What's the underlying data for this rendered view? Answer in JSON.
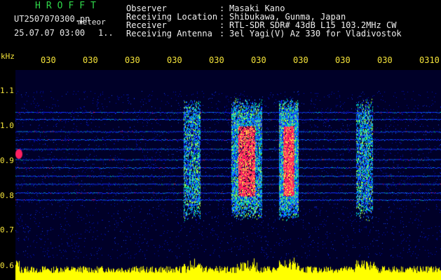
{
  "header": {
    "brand": "HROFFT",
    "filename": "UT2507070300.pn",
    "mode": "meteor",
    "datetime": "25.07.07 03:00",
    "page_indicator": "1.."
  },
  "station_info": [
    {
      "label": "Observer",
      "value": "Masaki Kano"
    },
    {
      "label": "Receiving Location",
      "value": "Shibukawa, Gunma, Japan"
    },
    {
      "label": "Receiver",
      "value": "RTL-SDR SDR# 43dB L15 103.2MHz CW"
    },
    {
      "label": "Receiving Antenna",
      "value": "3el Yagi(V) Az 330 for Vladivostok"
    }
  ],
  "separator": ":",
  "chart_data": {
    "type": "heatmap",
    "ylabel": "kHz",
    "y_ticks": [
      "1.1",
      "1.0",
      "0.9",
      "0.8",
      "0.7",
      "0.6"
    ],
    "ylim": [
      0.6,
      1.1
    ],
    "x_ticks": [
      "030",
      "030",
      "030",
      "030",
      "030",
      "030",
      "030",
      "030",
      "030",
      "0310"
    ],
    "x_minutes": [
      0,
      1,
      2,
      3,
      4,
      5,
      6,
      7,
      8,
      9,
      10
    ],
    "horizontal_traces_khz": [
      1.04,
      1.02,
      0.985,
      0.962,
      0.935,
      0.905,
      0.882,
      0.858,
      0.835,
      0.81,
      0.79
    ],
    "meteor_bursts_minute": [
      4.2,
      5.5,
      6.5,
      8.3
    ],
    "colors": {
      "background": "#000028",
      "noise": "#0018ff",
      "mid": "#00e0a0",
      "hot": "#ff2060",
      "level": "#ffff00",
      "ticks": "#f5e43a"
    }
  }
}
